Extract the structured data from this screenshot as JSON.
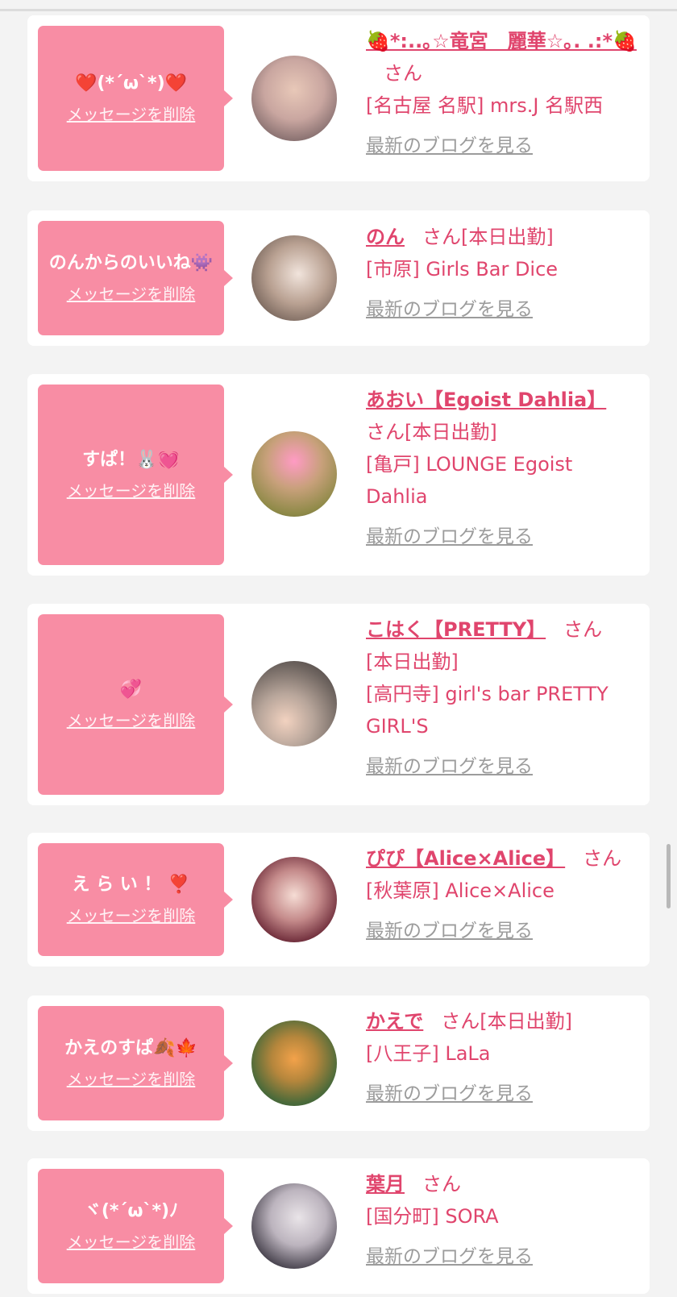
{
  "delete_label": "メッセージを削除",
  "blog_label": "最新のブログを見る",
  "colors": {
    "accent": "#e0456d",
    "bubble": "#f88da4",
    "muted": "#9c9c9c",
    "background": "#f3f3f3"
  },
  "items": [
    {
      "message": "❤️(*´ω`*)❤️",
      "name": "🍓*:..｡☆竜宮　麗華☆｡. .:*🍓",
      "san": "さん",
      "status": "",
      "shop": "[名古屋 名駅] mrs.J 名駅西"
    },
    {
      "message": "のんからのいいね👾",
      "name": "のん",
      "san": "さん",
      "status": "[本日出勤]",
      "shop": "[市原] Girls Bar Dice"
    },
    {
      "message": "すぱ！🐰💓",
      "name": "あおい【Egoist Dahlia】",
      "san": "さん",
      "status": "[本日出勤]",
      "shop": "[亀戸] LOUNGE Egoist Dahlia"
    },
    {
      "message": "💞",
      "name": "こはく【PRETTY】",
      "san": "さん",
      "status": "[本日出勤]",
      "shop": "[高円寺] girl's bar PRETTY GIRL'S"
    },
    {
      "message": "え ら い ！ ❣️",
      "name": "ぴぴ【Alice×Alice】",
      "san": "さん",
      "status": "",
      "shop": "[秋葉原] Alice×Alice"
    },
    {
      "message": "かえのすぱ🍂🍁",
      "name": "かえで",
      "san": "さん",
      "status": "[本日出勤]",
      "shop": "[八王子] LaLa"
    },
    {
      "message": "ヾ(*´ω`*)ﾉ",
      "name": "葉月",
      "san": "さん",
      "status": "",
      "shop": "[国分町] SORA"
    }
  ]
}
